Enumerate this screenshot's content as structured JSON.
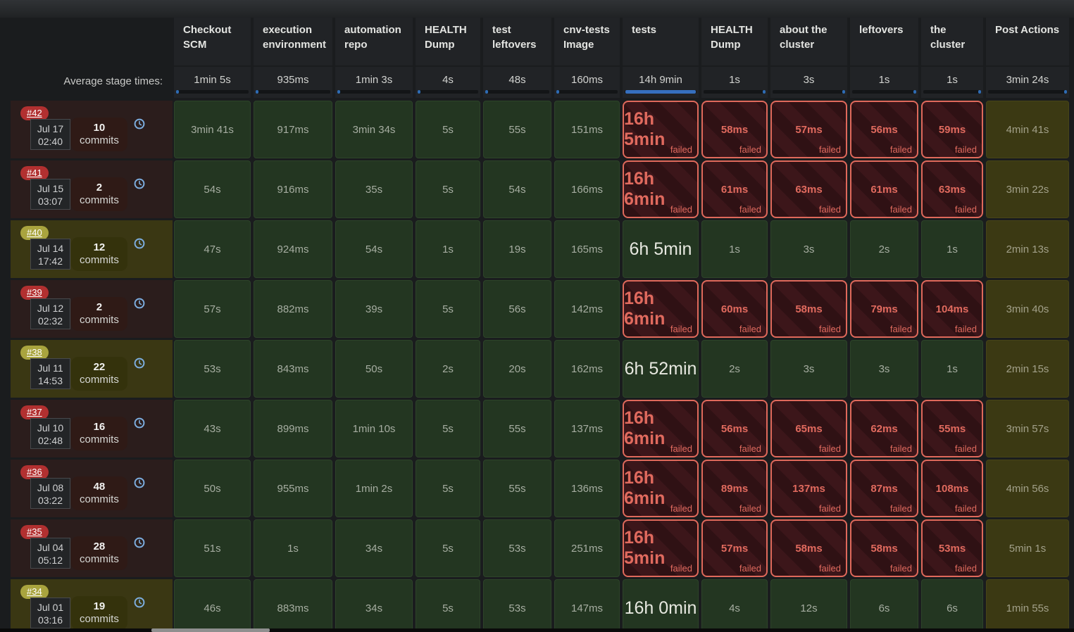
{
  "header": {
    "average_label": "Average stage times:",
    "columns": [
      {
        "label": "Checkout SCM",
        "avg": "1min 5s",
        "bar": "start"
      },
      {
        "label": "execution environment",
        "avg": "935ms",
        "bar": "start"
      },
      {
        "label": "automation repo",
        "avg": "1min 3s",
        "bar": "start"
      },
      {
        "label": "HEALTH Dump",
        "avg": "4s",
        "bar": "start"
      },
      {
        "label": "test leftovers",
        "avg": "48s",
        "bar": "start"
      },
      {
        "label": "cnv-tests Image",
        "avg": "160ms",
        "bar": "start"
      },
      {
        "label": "tests",
        "avg": "14h 9min",
        "bar": "full"
      },
      {
        "label": "HEALTH Dump",
        "avg": "1s",
        "bar": "end"
      },
      {
        "label": "about the cluster",
        "avg": "3s",
        "bar": "end"
      },
      {
        "label": "leftovers",
        "avg": "1s",
        "bar": "end"
      },
      {
        "label": "the cluster",
        "avg": "1s",
        "bar": "end"
      },
      {
        "label": "Post Actions",
        "avg": "3min 24s",
        "bar": "end"
      }
    ]
  },
  "labels": {
    "failed": "failed",
    "commits": "commits"
  },
  "colors": {
    "failed_accent": "#df695b",
    "success_bg": "#233621",
    "unstable_bg": "#3b3913",
    "badge_failed": "#b23030",
    "badge_unstable": "#a9a43e",
    "avg_bar_blue": "#2e6cb4"
  },
  "builds": [
    {
      "id": "#42",
      "status": "failed",
      "date": "Jul 17",
      "time": "02:40",
      "commits": "10",
      "stages": [
        {
          "t": "3min 41s",
          "k": "ok"
        },
        {
          "t": "917ms",
          "k": "ok"
        },
        {
          "t": "3min 34s",
          "k": "ok"
        },
        {
          "t": "5s",
          "k": "ok"
        },
        {
          "t": "55s",
          "k": "ok"
        },
        {
          "t": "151ms",
          "k": "ok"
        },
        {
          "t": "16h 5min",
          "k": "failbig"
        },
        {
          "t": "58ms",
          "k": "fail"
        },
        {
          "t": "57ms",
          "k": "fail"
        },
        {
          "t": "56ms",
          "k": "fail"
        },
        {
          "t": "59ms",
          "k": "fail"
        },
        {
          "t": "4min 41s",
          "k": "post"
        }
      ]
    },
    {
      "id": "#41",
      "status": "failed",
      "date": "Jul 15",
      "time": "03:07",
      "commits": "2",
      "stages": [
        {
          "t": "54s",
          "k": "ok"
        },
        {
          "t": "916ms",
          "k": "ok"
        },
        {
          "t": "35s",
          "k": "ok"
        },
        {
          "t": "5s",
          "k": "ok"
        },
        {
          "t": "54s",
          "k": "ok"
        },
        {
          "t": "166ms",
          "k": "ok"
        },
        {
          "t": "16h 6min",
          "k": "failbig"
        },
        {
          "t": "61ms",
          "k": "fail"
        },
        {
          "t": "63ms",
          "k": "fail"
        },
        {
          "t": "61ms",
          "k": "fail"
        },
        {
          "t": "63ms",
          "k": "fail"
        },
        {
          "t": "3min 22s",
          "k": "post"
        }
      ]
    },
    {
      "id": "#40",
      "status": "unstable",
      "date": "Jul 14",
      "time": "17:42",
      "commits": "12",
      "stages": [
        {
          "t": "47s",
          "k": "ok"
        },
        {
          "t": "924ms",
          "k": "ok"
        },
        {
          "t": "54s",
          "k": "ok"
        },
        {
          "t": "1s",
          "k": "ok"
        },
        {
          "t": "19s",
          "k": "ok"
        },
        {
          "t": "165ms",
          "k": "ok"
        },
        {
          "t": "6h 5min",
          "k": "okbig"
        },
        {
          "t": "1s",
          "k": "ok"
        },
        {
          "t": "3s",
          "k": "ok"
        },
        {
          "t": "2s",
          "k": "ok"
        },
        {
          "t": "1s",
          "k": "ok"
        },
        {
          "t": "2min 13s",
          "k": "post"
        }
      ]
    },
    {
      "id": "#39",
      "status": "failed",
      "date": "Jul 12",
      "time": "02:32",
      "commits": "2",
      "stages": [
        {
          "t": "57s",
          "k": "ok"
        },
        {
          "t": "882ms",
          "k": "ok"
        },
        {
          "t": "39s",
          "k": "ok"
        },
        {
          "t": "5s",
          "k": "ok"
        },
        {
          "t": "56s",
          "k": "ok"
        },
        {
          "t": "142ms",
          "k": "ok"
        },
        {
          "t": "16h 6min",
          "k": "failbig"
        },
        {
          "t": "60ms",
          "k": "fail"
        },
        {
          "t": "58ms",
          "k": "fail"
        },
        {
          "t": "79ms",
          "k": "fail"
        },
        {
          "t": "104ms",
          "k": "fail"
        },
        {
          "t": "3min 40s",
          "k": "post"
        }
      ]
    },
    {
      "id": "#38",
      "status": "unstable",
      "date": "Jul 11",
      "time": "14:53",
      "commits": "22",
      "stages": [
        {
          "t": "53s",
          "k": "ok"
        },
        {
          "t": "843ms",
          "k": "ok"
        },
        {
          "t": "50s",
          "k": "ok"
        },
        {
          "t": "2s",
          "k": "ok"
        },
        {
          "t": "20s",
          "k": "ok"
        },
        {
          "t": "162ms",
          "k": "ok"
        },
        {
          "t": "6h 52min",
          "k": "okbig"
        },
        {
          "t": "2s",
          "k": "ok"
        },
        {
          "t": "3s",
          "k": "ok"
        },
        {
          "t": "3s",
          "k": "ok"
        },
        {
          "t": "1s",
          "k": "ok"
        },
        {
          "t": "2min 15s",
          "k": "post"
        }
      ]
    },
    {
      "id": "#37",
      "status": "failed",
      "date": "Jul 10",
      "time": "02:48",
      "commits": "16",
      "stages": [
        {
          "t": "43s",
          "k": "ok"
        },
        {
          "t": "899ms",
          "k": "ok"
        },
        {
          "t": "1min 10s",
          "k": "ok"
        },
        {
          "t": "5s",
          "k": "ok"
        },
        {
          "t": "55s",
          "k": "ok"
        },
        {
          "t": "137ms",
          "k": "ok"
        },
        {
          "t": "16h 6min",
          "k": "failbig"
        },
        {
          "t": "56ms",
          "k": "fail"
        },
        {
          "t": "65ms",
          "k": "fail"
        },
        {
          "t": "62ms",
          "k": "fail"
        },
        {
          "t": "55ms",
          "k": "fail"
        },
        {
          "t": "3min 57s",
          "k": "post"
        }
      ]
    },
    {
      "id": "#36",
      "status": "failed",
      "date": "Jul 08",
      "time": "03:22",
      "commits": "48",
      "stages": [
        {
          "t": "50s",
          "k": "ok"
        },
        {
          "t": "955ms",
          "k": "ok"
        },
        {
          "t": "1min 2s",
          "k": "ok"
        },
        {
          "t": "5s",
          "k": "ok"
        },
        {
          "t": "55s",
          "k": "ok"
        },
        {
          "t": "136ms",
          "k": "ok"
        },
        {
          "t": "16h 6min",
          "k": "failbig"
        },
        {
          "t": "89ms",
          "k": "fail"
        },
        {
          "t": "137ms",
          "k": "fail"
        },
        {
          "t": "87ms",
          "k": "fail"
        },
        {
          "t": "108ms",
          "k": "fail"
        },
        {
          "t": "4min 56s",
          "k": "post"
        }
      ]
    },
    {
      "id": "#35",
      "status": "failed",
      "date": "Jul 04",
      "time": "05:12",
      "commits": "28",
      "stages": [
        {
          "t": "51s",
          "k": "ok"
        },
        {
          "t": "1s",
          "k": "ok"
        },
        {
          "t": "34s",
          "k": "ok"
        },
        {
          "t": "5s",
          "k": "ok"
        },
        {
          "t": "53s",
          "k": "ok"
        },
        {
          "t": "251ms",
          "k": "ok"
        },
        {
          "t": "16h 5min",
          "k": "failbig"
        },
        {
          "t": "57ms",
          "k": "fail"
        },
        {
          "t": "58ms",
          "k": "fail"
        },
        {
          "t": "58ms",
          "k": "fail"
        },
        {
          "t": "53ms",
          "k": "fail"
        },
        {
          "t": "5min 1s",
          "k": "post"
        }
      ]
    },
    {
      "id": "#34",
      "status": "unstable",
      "date": "Jul 01",
      "time": "03:16",
      "commits": "19",
      "stages": [
        {
          "t": "46s",
          "k": "ok"
        },
        {
          "t": "883ms",
          "k": "ok"
        },
        {
          "t": "34s",
          "k": "ok"
        },
        {
          "t": "5s",
          "k": "ok"
        },
        {
          "t": "53s",
          "k": "ok"
        },
        {
          "t": "147ms",
          "k": "ok"
        },
        {
          "t": "16h 0min",
          "k": "okbig"
        },
        {
          "t": "4s",
          "k": "ok"
        },
        {
          "t": "12s",
          "k": "ok"
        },
        {
          "t": "6s",
          "k": "ok"
        },
        {
          "t": "6s",
          "k": "ok"
        },
        {
          "t": "1min 55s",
          "k": "post"
        }
      ]
    }
  ]
}
